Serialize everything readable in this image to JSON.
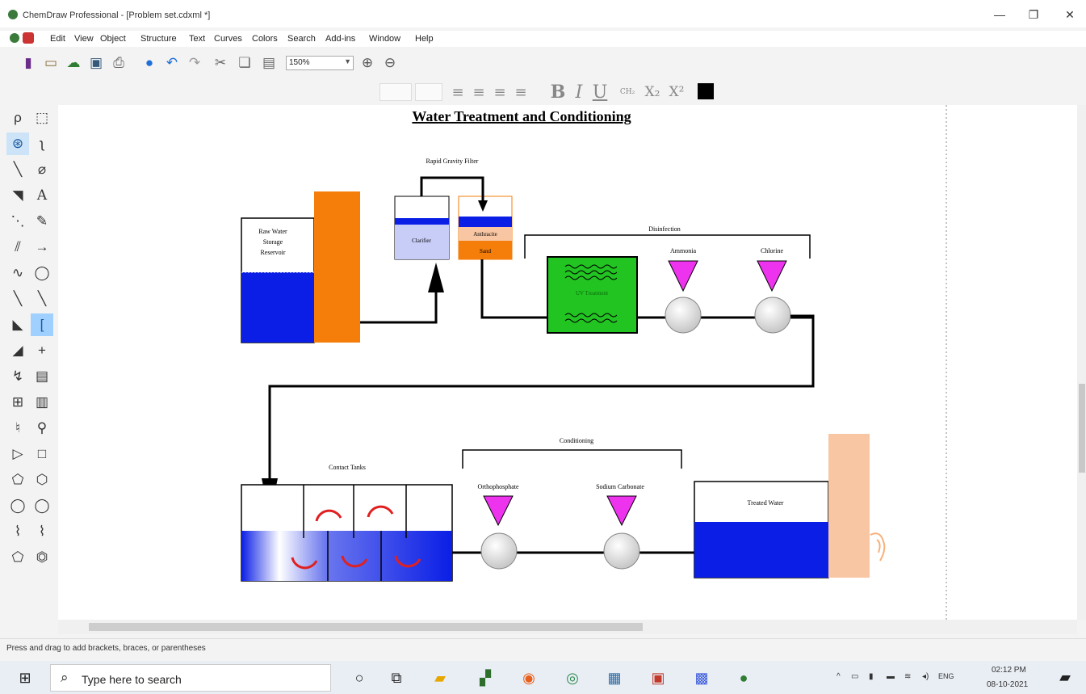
{
  "window": {
    "title": "ChemDraw Professional - [Problem set.cdxml *]",
    "controls": [
      "—",
      "❐",
      "✕"
    ]
  },
  "menu": [
    "Edit",
    "View",
    "Object",
    "Structure",
    "Text",
    "Curves",
    "Colors",
    "Search",
    "Add-ins",
    "Window",
    "Help"
  ],
  "toolbar": {
    "zoom_value": "150%"
  },
  "format_bar": {
    "bold": "B",
    "italic": "I",
    "underline": "U",
    "subscript": "X₂",
    "superscript": "X²"
  },
  "diagram": {
    "title": "Water Treatment and Conditioning",
    "labels": {
      "raw_water": "Raw Water Storage Reservoir",
      "rapid_filter": "Rapid Gravity Filter",
      "clarifier": "Clarifier",
      "anthracite": "Anthracite",
      "sand": "Sand",
      "disinfection": "Disinfection",
      "uv": "UV Treatment",
      "ammonia": "Ammonia",
      "chlorine": "Chlorine",
      "contact_tanks": "Contact Tanks",
      "conditioning": "Conditioning",
      "orthophosphate": "Orthophosphate",
      "sodium_carbonate": "Sodium Carbonate",
      "treated_water": "Treated Water"
    },
    "colors": {
      "water": "#0a1ee6",
      "tower": "#f57d0a",
      "tower_light": "#f8c6a2",
      "uv_green": "#22c422",
      "chemical": "#ee33ee",
      "clarifier_fill": "#c8cdf8"
    }
  },
  "status": "Press and drag to add brackets, braces, or parentheses",
  "taskbar": {
    "search_placeholder": "Type here to search",
    "time": "02:12 PM",
    "date": "08-10-2021",
    "lang": "ENG"
  }
}
